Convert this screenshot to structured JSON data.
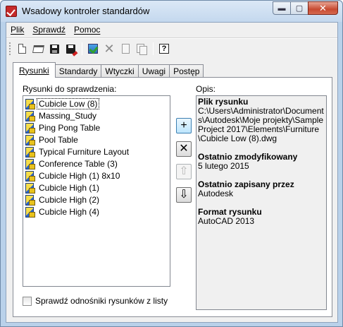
{
  "window": {
    "title": "Wsadowy kontroler standardów",
    "controls": {
      "minimize": "▬",
      "maximize": "▢",
      "close": "✕"
    }
  },
  "menu": {
    "items": [
      {
        "label": "Plik"
      },
      {
        "label": "Sprawdź"
      },
      {
        "label": "Pomoc"
      }
    ]
  },
  "toolbar": {
    "buttons": [
      {
        "icon": "new-document-icon"
      },
      {
        "icon": "open-folder-icon"
      },
      {
        "icon": "save-icon"
      },
      {
        "icon": "save-as-icon"
      },
      {
        "icon": "start-check-icon"
      },
      {
        "icon": "delete-icon"
      },
      {
        "icon": "document-icon"
      },
      {
        "icon": "documents-icon"
      },
      {
        "icon": "help-icon",
        "glyph": "?"
      }
    ]
  },
  "tabs": [
    {
      "label": "Rysunki",
      "active": true
    },
    {
      "label": "Standardy"
    },
    {
      "label": "Wtyczki"
    },
    {
      "label": "Uwagi"
    },
    {
      "label": "Postęp"
    }
  ],
  "drawings": {
    "label": "Rysunki do sprawdzenia:",
    "items": [
      "Cubicle Low (8)",
      "Massing_Study",
      "Ping Pong Table",
      "Pool Table",
      "Typical Furniture Layout",
      "Conference Table (3)",
      "Cubicle High (1) 8x10",
      "Cubicle High (1)",
      "Cubicle High (2)",
      "Cubicle High (4)"
    ],
    "selected_index": 0
  },
  "side_buttons": {
    "add": "+",
    "remove": "✕",
    "up": "⇧",
    "down": "⇩"
  },
  "description": {
    "label": "Opis:",
    "file_heading": "Plik rysunku",
    "file_value": "C:\\Users\\Administrator\\Documents\\Autodesk\\Moje projekty\\Sample Project 2017\\Elements\\Furniture\\Cubicle Low (8).dwg",
    "modified_heading": "Ostatnio zmodyfikowany",
    "modified_value": "5 lutego 2015",
    "saved_by_heading": "Ostatnio zapisany przez",
    "saved_by_value": "Autodesk",
    "format_heading": "Format rysunku",
    "format_value": "AutoCAD 2013"
  },
  "check_references": {
    "label": "Sprawdź odnośniki rysunków z listy",
    "checked": false
  },
  "colors": {
    "title_bg": "#c4d8ee",
    "close_button": "#c74a31",
    "dialog_bg": "#f0f0f0"
  }
}
